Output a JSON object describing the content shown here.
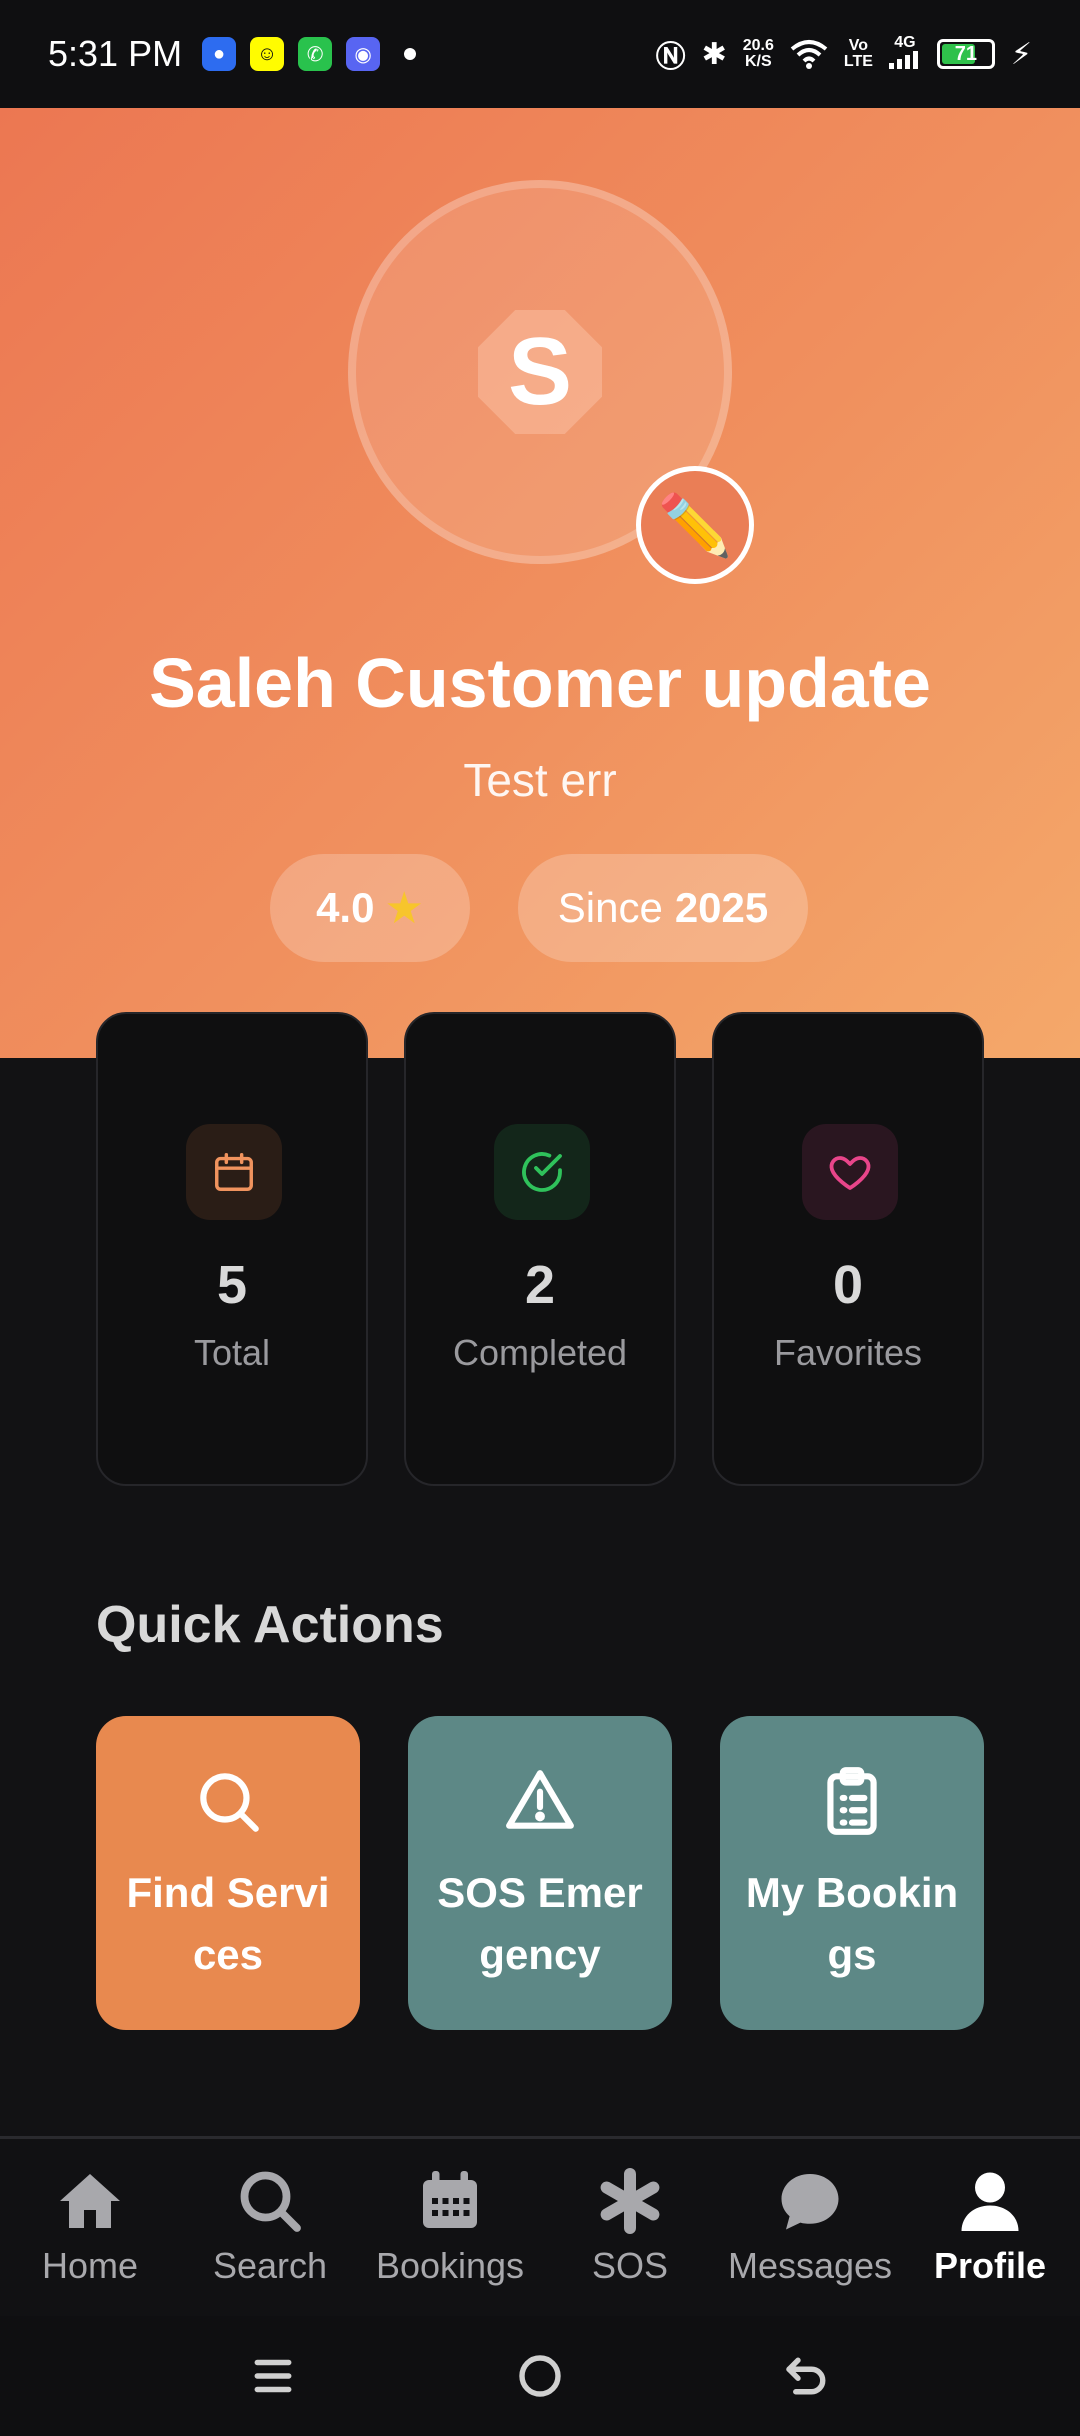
{
  "status": {
    "time": "5:31 PM",
    "net_speed_value": "20.6",
    "net_speed_unit": "K/S",
    "volte_top": "Vo",
    "volte_bottom": "LTE",
    "signal_label": "4G",
    "battery": "71",
    "battery_level_percent": 71
  },
  "profile": {
    "initial": "S",
    "name": "Saleh Customer update",
    "subtitle": "Test err",
    "rating": "4.0",
    "since_prefix": "Since",
    "since_year": "2025"
  },
  "stats": [
    {
      "value": "5",
      "label": "Total",
      "icon": "calendar-icon",
      "color": "#f0935e"
    },
    {
      "value": "2",
      "label": "Completed",
      "icon": "check-circle-icon",
      "color": "#2fc25b"
    },
    {
      "value": "0",
      "label": "Favorites",
      "icon": "heart-icon",
      "color": "#e8458a"
    }
  ],
  "quick_actions": {
    "title": "Quick Actions",
    "items": [
      {
        "label": "Find Services",
        "icon": "search-icon",
        "color": "#e8894f"
      },
      {
        "label": "SOS Emergency",
        "icon": "warning-icon",
        "color": "#5d8886"
      },
      {
        "label": "My Bookings",
        "icon": "clipboard-icon",
        "color": "#5d8886"
      }
    ]
  },
  "nav": [
    {
      "label": "Home",
      "icon": "home-icon"
    },
    {
      "label": "Search",
      "icon": "search-icon"
    },
    {
      "label": "Bookings",
      "icon": "calendar-icon"
    },
    {
      "label": "SOS",
      "icon": "asterisk-icon"
    },
    {
      "label": "Messages",
      "icon": "chat-icon"
    },
    {
      "label": "Profile",
      "icon": "person-icon",
      "active": true
    }
  ],
  "colors": {
    "accent": "#ec7752",
    "background": "#121214",
    "teal": "#5d8886"
  }
}
